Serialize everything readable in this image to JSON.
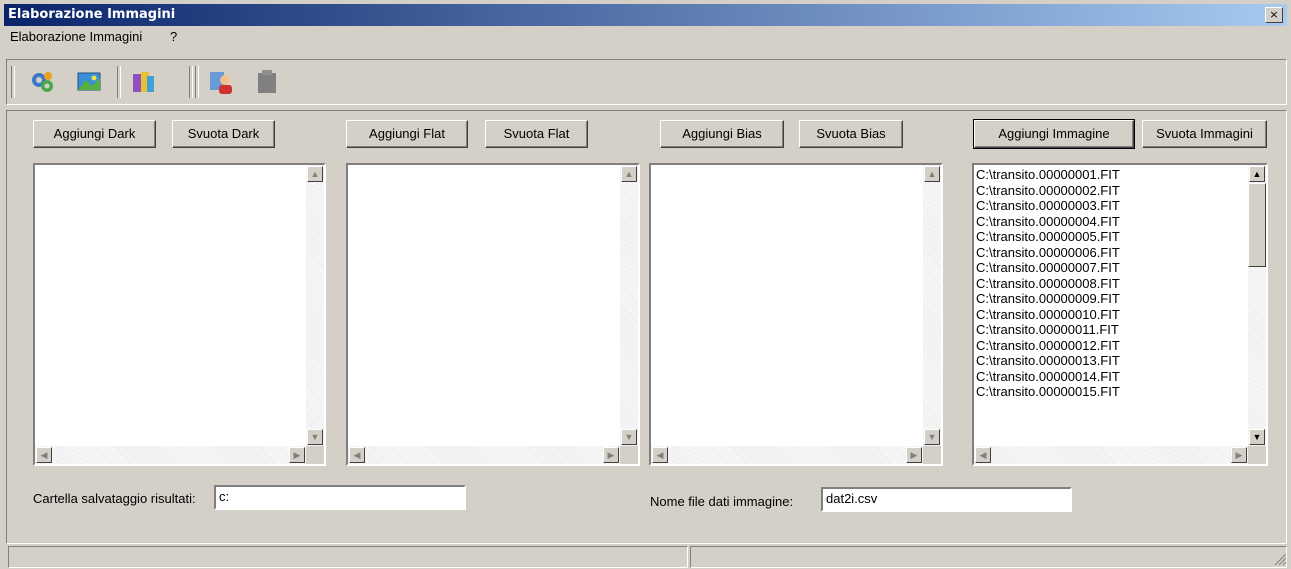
{
  "window": {
    "title": "Elaborazione Immagini",
    "close_glyph": "×"
  },
  "menu": {
    "items": [
      "Elaborazione Immagini",
      "?"
    ]
  },
  "toolbar": {
    "icons": [
      "process-gears-icon",
      "image-icon",
      "calculator-icon",
      "user-person-icon",
      "stop-disabled-icon"
    ]
  },
  "panels": {
    "dark": {
      "add_label": "Aggiungi Dark",
      "clear_label": "Svuota Dark",
      "items": []
    },
    "flat": {
      "add_label": "Aggiungi Flat",
      "clear_label": "Svuota Flat",
      "items": []
    },
    "bias": {
      "add_label": "Aggiungi Bias",
      "clear_label": "Svuota Bias",
      "items": []
    },
    "images": {
      "add_label": "Aggiungi Immagine",
      "clear_label": "Svuota Immagini",
      "items": [
        "C:\\transito.00000001.FIT",
        "C:\\transito.00000002.FIT",
        "C:\\transito.00000003.FIT",
        "C:\\transito.00000004.FIT",
        "C:\\transito.00000005.FIT",
        "C:\\transito.00000006.FIT",
        "C:\\transito.00000007.FIT",
        "C:\\transito.00000008.FIT",
        "C:\\transito.00000009.FIT",
        "C:\\transito.00000010.FIT",
        "C:\\transito.00000011.FIT",
        "C:\\transito.00000012.FIT",
        "C:\\transito.00000013.FIT",
        "C:\\transito.00000014.FIT",
        "C:\\transito.00000015.FIT"
      ]
    }
  },
  "results_folder": {
    "label": "Cartella salvataggio risultati:",
    "value": "c:"
  },
  "data_file": {
    "label": "Nome file dati immagine:",
    "value": "dat2i.csv"
  },
  "colors": {
    "title_start": "#0a246a",
    "title_end": "#a6caf0",
    "face": "#d4d0c8"
  }
}
